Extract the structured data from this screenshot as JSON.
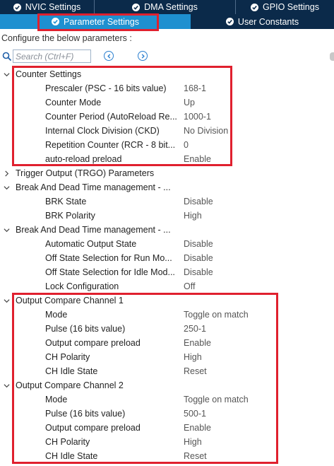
{
  "tabs_top": [
    {
      "label": "NVIC Settings"
    },
    {
      "label": "DMA Settings"
    },
    {
      "label": "GPIO Settings"
    }
  ],
  "tabs_bottom": [
    {
      "label": "Parameter Settings",
      "active": true
    },
    {
      "label": "User Constants",
      "active": false
    }
  ],
  "config_text": "Configure the below parameters :",
  "search": {
    "placeholder": "Search (Ctrl+F)"
  },
  "colors": {
    "tab_bg": "#0b2a4a",
    "active_tab": "#1e90d0",
    "highlight": "#e0202e"
  },
  "groups": [
    {
      "title": "Counter Settings",
      "expanded": true,
      "params": [
        {
          "label": "Prescaler (PSC - 16 bits value)",
          "value": "168-1"
        },
        {
          "label": "Counter Mode",
          "value": "Up"
        },
        {
          "label": "Counter Period (AutoReload Re...",
          "value": "1000-1"
        },
        {
          "label": "Internal Clock Division (CKD)",
          "value": "No Division"
        },
        {
          "label": "Repetition Counter (RCR - 8 bit...",
          "value": "0"
        },
        {
          "label": "auto-reload preload",
          "value": "Enable"
        }
      ]
    },
    {
      "title": "Trigger Output (TRGO) Parameters",
      "expanded": false,
      "params": []
    },
    {
      "title": "Break And Dead Time management - ...",
      "expanded": true,
      "params": [
        {
          "label": "BRK State",
          "value": "Disable"
        },
        {
          "label": "BRK Polarity",
          "value": "High"
        }
      ]
    },
    {
      "title": "Break And Dead Time management - ...",
      "expanded": true,
      "params": [
        {
          "label": "Automatic Output State",
          "value": "Disable"
        },
        {
          "label": "Off State Selection for Run Mo...",
          "value": "Disable"
        },
        {
          "label": "Off State Selection for Idle Mod...",
          "value": "Disable"
        },
        {
          "label": "Lock Configuration",
          "value": "Off"
        }
      ]
    },
    {
      "title": "Output Compare Channel 1",
      "expanded": true,
      "params": [
        {
          "label": "Mode",
          "value": "Toggle on match"
        },
        {
          "label": "Pulse (16 bits value)",
          "value": "250-1"
        },
        {
          "label": "Output compare preload",
          "value": "Enable"
        },
        {
          "label": "CH Polarity",
          "value": "High"
        },
        {
          "label": "CH Idle State",
          "value": "Reset"
        }
      ]
    },
    {
      "title": "Output Compare Channel 2",
      "expanded": true,
      "params": [
        {
          "label": "Mode",
          "value": "Toggle on match"
        },
        {
          "label": "Pulse (16 bits value)",
          "value": "500-1"
        },
        {
          "label": "Output compare preload",
          "value": "Enable"
        },
        {
          "label": "CH Polarity",
          "value": "High"
        },
        {
          "label": "CH Idle State",
          "value": "Reset"
        }
      ]
    }
  ]
}
